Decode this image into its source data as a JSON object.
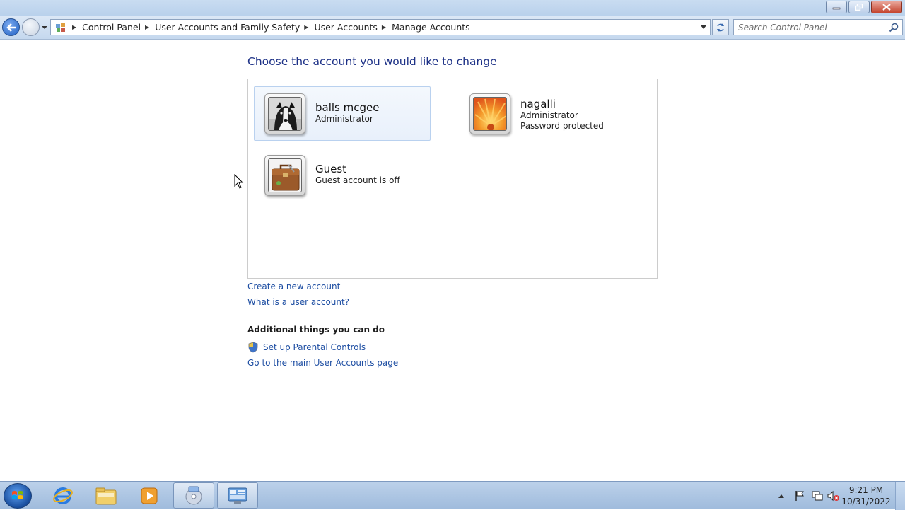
{
  "address_bar": {
    "crumbs": [
      "Control Panel",
      "User Accounts and Family Safety",
      "User Accounts",
      "Manage Accounts"
    ]
  },
  "search": {
    "placeholder": "Search Control Panel"
  },
  "main": {
    "heading": "Choose the account you would like to change",
    "accounts": [
      {
        "name": "balls mcgee",
        "lines": [
          "Administrator"
        ],
        "picture": "dog-picture",
        "selected": true
      },
      {
        "name": "nagalli",
        "lines": [
          "Administrator",
          "Password protected"
        ],
        "picture": "orange-flower-picture",
        "selected": false
      },
      {
        "name": "Guest",
        "lines": [
          "Guest account is off"
        ],
        "picture": "briefcase-picture",
        "selected": false
      }
    ],
    "links": {
      "create_account": "Create a new account",
      "what_is_account": "What is a user account?"
    },
    "additional": {
      "heading": "Additional things you can do",
      "parental_controls": "Set up Parental Controls",
      "main_page": "Go to the main User Accounts page"
    }
  },
  "taskbar": {
    "items": [
      "start-orb-icon",
      "internet-explorer-icon",
      "file-explorer-icon",
      "media-player-icon",
      "cd-program-icon",
      "control-panel-icon"
    ],
    "clock": {
      "time": "9:21 PM",
      "date": "10/31/2022"
    },
    "tray_icons": [
      "show-hidden-icons-arrow",
      "action-center-flag-icon",
      "network-icon",
      "volume-muted-icon"
    ]
  },
  "colors": {
    "link": "#1f4fa3",
    "heading": "#1e3287",
    "selected_bg": "#e8f0fb"
  }
}
